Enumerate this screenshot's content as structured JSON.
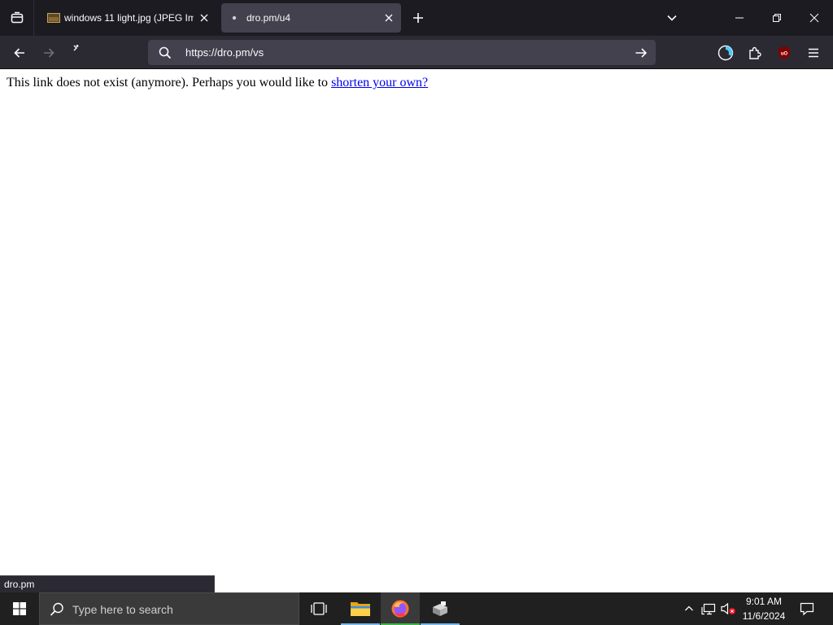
{
  "browser": {
    "tabs": [
      {
        "title": "windows 11 light.jpg (JPEG Ima",
        "active": false
      },
      {
        "title": "dro.pm/u4",
        "active": true
      }
    ],
    "url": "https://dro.pm/vs"
  },
  "page": {
    "message_text": "This link does not exist (anymore). Perhaps you would like to ",
    "link_text": "shorten your own?"
  },
  "status_text": "dro.pm",
  "taskbar": {
    "search_placeholder": "Type here to search",
    "time": "9:01 AM",
    "date": "11/6/2024"
  },
  "colors": {
    "tabstrip_bg": "#1c1b22",
    "toolbar_bg": "#2b2a33",
    "urlbar_bg": "#42414d",
    "link": "#0000ee",
    "taskbar_bg": "#202020",
    "ublock_red": "#800000"
  },
  "icons": [
    "tab-list-icon",
    "image-favicon",
    "dot-favicon",
    "close-icon",
    "plus-icon",
    "chevron-down-icon",
    "minimize-icon",
    "restore-icon",
    "back-arrow-icon",
    "forward-arrow-icon",
    "reload-icon",
    "search-icon",
    "arrow-right-icon",
    "profile-sync-icon",
    "extensions-icon",
    "ublock-icon",
    "hamburger-menu-icon",
    "windows-logo-icon",
    "task-view-icon",
    "folder-icon",
    "firefox-icon",
    "app-icon",
    "chevron-up-icon",
    "network-icon",
    "speaker-muted-icon",
    "notification-icon"
  ]
}
